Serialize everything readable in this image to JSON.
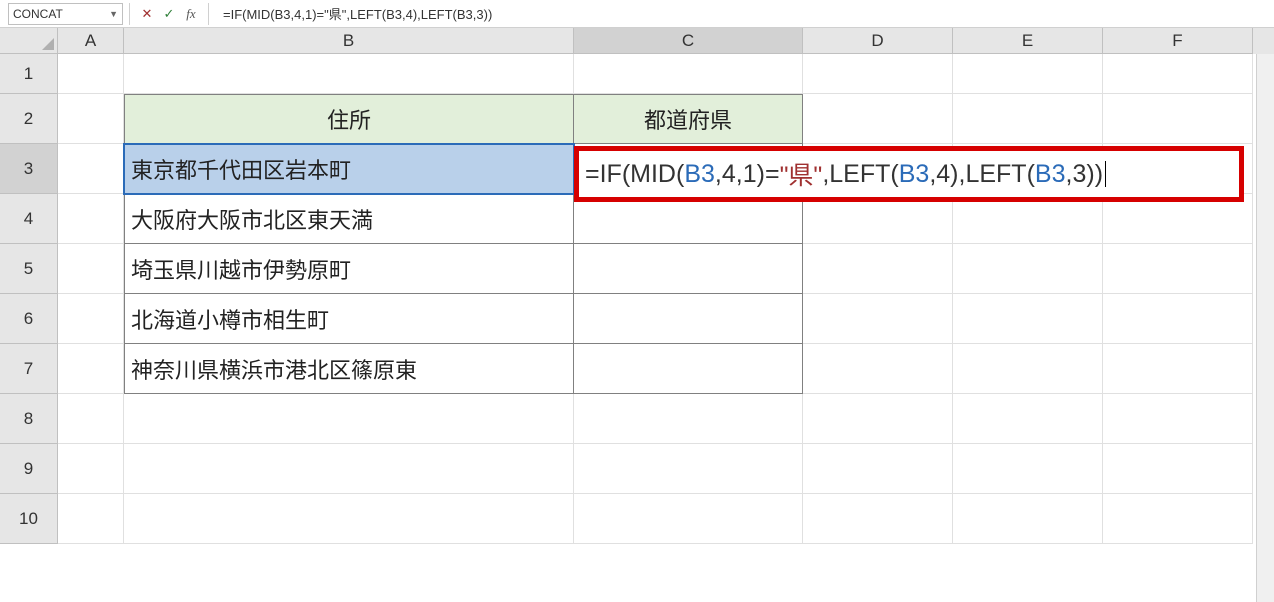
{
  "name_box": "CONCAT",
  "formula_text": "=IF(MID(B3,4,1)=\"県\",LEFT(B3,4),LEFT(B3,3))",
  "columns": [
    "A",
    "B",
    "C",
    "D",
    "E",
    "F"
  ],
  "active_col": "C",
  "active_row": "3",
  "rows": [
    "1",
    "2",
    "3",
    "4",
    "5",
    "6",
    "7",
    "8",
    "9",
    "10"
  ],
  "headers": {
    "B2": "住所",
    "C2": "都道府県"
  },
  "data": {
    "B3": "東京都千代田区岩本町",
    "B4": "大阪府大阪市北区東天満",
    "B5": "埼玉県川越市伊勢原町",
    "B6": "北海道小樽市相生町",
    "B7": "神奈川県横浜市港北区篠原東"
  },
  "formula_overlay": {
    "eq": "=",
    "if": "IF",
    "mid": "MID",
    "left": "LEFT",
    "ref": "B3",
    "n4": "4",
    "n1": "1",
    "n3": "3",
    "str": "\"県\""
  }
}
